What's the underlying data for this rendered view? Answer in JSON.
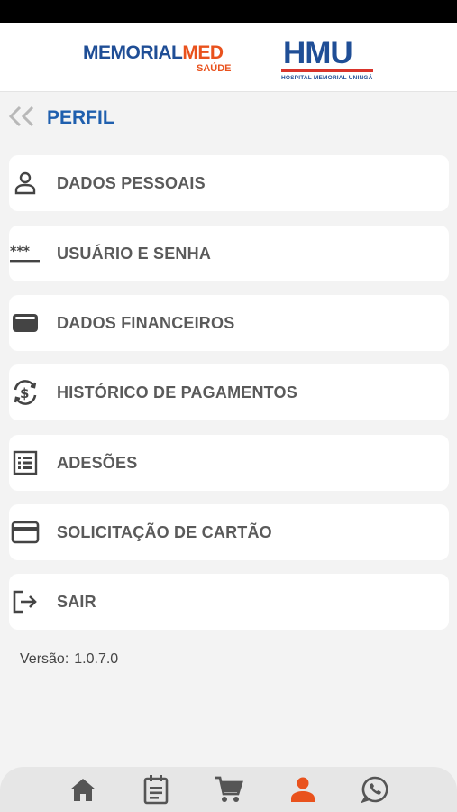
{
  "header": {
    "memorialmed_logo": {
      "word_part1": "MEMORIAL",
      "word_part2": "MED",
      "sub": "SAÚDE"
    },
    "hmu_logo": {
      "letters": "HMU",
      "caption": "HOSPITAL MEMORIAL UNINGÁ"
    }
  },
  "page": {
    "title": "PERFIL",
    "back_icon": "double-chevron-left-icon"
  },
  "menu": [
    {
      "label": "DADOS PESSOAIS",
      "icon": "person-icon"
    },
    {
      "label": "USUÁRIO E SENHA",
      "icon": "password-asterisks-icon"
    },
    {
      "label": "DADOS FINANCEIROS",
      "icon": "wallet-icon"
    },
    {
      "label": "HISTÓRICO DE PAGAMENTOS",
      "icon": "payment-history-icon"
    },
    {
      "label": "ADESÕES",
      "icon": "list-icon"
    },
    {
      "label": "SOLICITAÇÃO DE CARTÃO",
      "icon": "credit-card-icon"
    },
    {
      "label": "SAIR",
      "icon": "logout-icon"
    }
  ],
  "version": {
    "label": "Versão:",
    "value": "1.0.7.0"
  },
  "bottom_nav": [
    {
      "icon": "home-icon",
      "active": false
    },
    {
      "icon": "document-icon",
      "active": false
    },
    {
      "icon": "cart-icon",
      "active": false
    },
    {
      "icon": "profile-icon",
      "active": true
    },
    {
      "icon": "whatsapp-icon",
      "active": false
    }
  ],
  "colors": {
    "accent": "#e9521d",
    "brand_blue": "#1f4e96",
    "title_blue": "#1f5fae",
    "icon_gray": "#444444",
    "nav_gray": "#555555"
  }
}
